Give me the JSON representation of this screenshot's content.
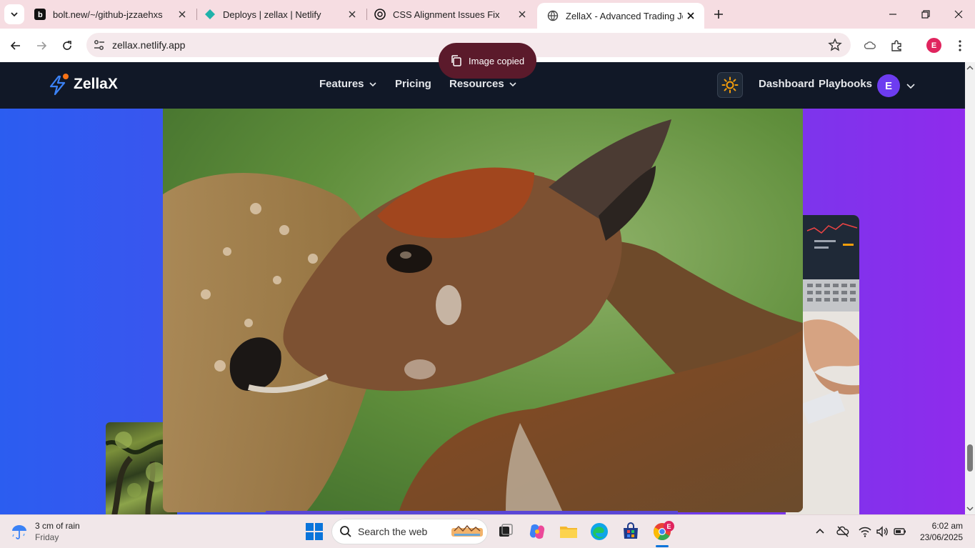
{
  "browser": {
    "tabs": [
      {
        "title": "bolt.new/~/github-jzzaehxs",
        "favicon": "bolt-icon"
      },
      {
        "title": "Deploys | zellax | Netlify",
        "favicon": "netlify-icon"
      },
      {
        "title": "CSS Alignment Issues Fix",
        "favicon": "openai-icon"
      },
      {
        "title": "ZellaX - Advanced Trading Journ",
        "favicon": "globe-icon",
        "active": true
      }
    ],
    "url": "zellax.netlify.app",
    "profile_initial": "E",
    "toast": "Image copied"
  },
  "site": {
    "brand": "ZellaX",
    "nav": {
      "features": "Features",
      "pricing": "Pricing",
      "resources": "Resources",
      "dashboard": "Dashboard",
      "playbooks": "Playbooks"
    },
    "user_initial": "E",
    "colors": {
      "nav_bg": "#111827",
      "gradient_start": "#2b5df0",
      "gradient_end": "#8f2bec",
      "accent": "#f59e0b"
    }
  },
  "taskbar": {
    "weather_line1": "3 cm of rain",
    "weather_line2": "Friday",
    "search_placeholder": "Search the web",
    "time": "6:02 am",
    "date": "23/06/2025",
    "chrome_badge": "E"
  }
}
